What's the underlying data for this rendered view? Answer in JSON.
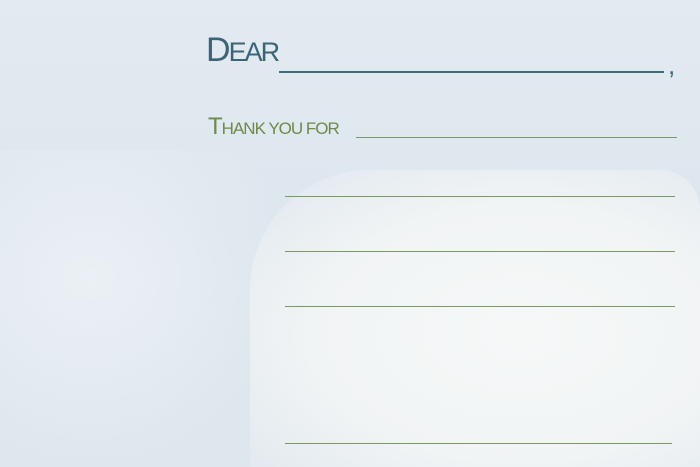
{
  "card": {
    "greeting_initial": "D",
    "greeting_rest": "EAR",
    "greeting_punctuation": ",",
    "thanks_initial": "T",
    "thanks_rest": "HANK YOU FOR",
    "colors": {
      "greeting": "#3a6577",
      "thanks": "#6f8a4a",
      "background": "#dfe7ef"
    }
  }
}
